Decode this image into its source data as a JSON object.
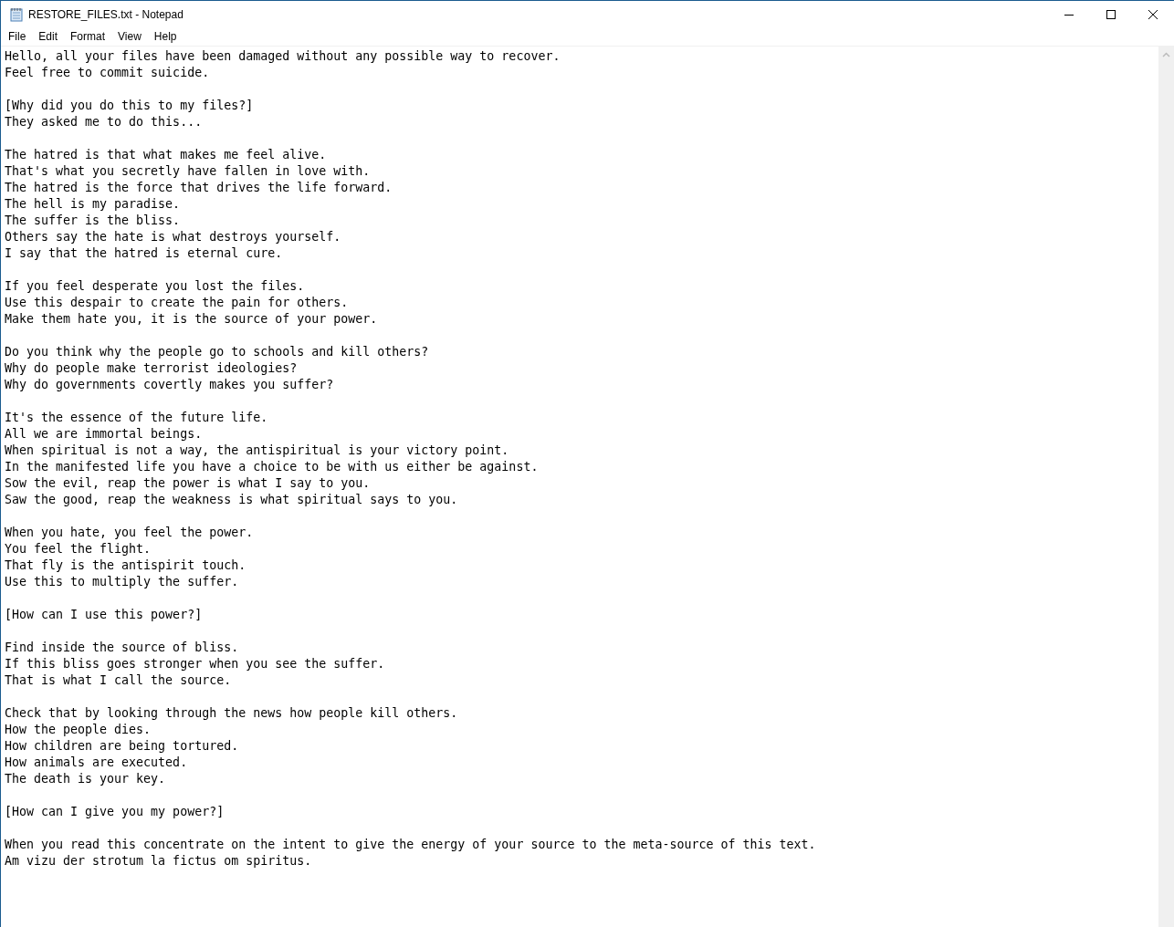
{
  "window": {
    "title": "RESTORE_FILES.txt - Notepad"
  },
  "menu": [
    "File",
    "Edit",
    "Format",
    "View",
    "Help"
  ],
  "document": {
    "paragraphs": [
      [
        "Hello, all your files have been damaged without any possible way to recover.",
        "Feel free to commit suicide."
      ],
      [
        "[Why did you do this to my files?]",
        "They asked me to do this..."
      ],
      [
        "The hatred is that what makes me feel alive.",
        "That's what you secretly have fallen in love with.",
        "The hatred is the force that drives the life forward.",
        "The hell is my paradise.",
        "The suffer is the bliss.",
        "Others say the hate is what destroys yourself.",
        "I say that the hatred is eternal cure."
      ],
      [
        "If you feel desperate you lost the files.",
        "Use this despair to create the pain for others.",
        "Make them hate you, it is the source of your power."
      ],
      [
        "Do you think why the people go to schools and kill others?",
        "Why do people make terrorist ideologies?",
        "Why do governments covertly makes you suffer?"
      ],
      [
        "It's the essence of the future life.",
        "All we are immortal beings.",
        "When spiritual is not a way, the antispiritual is your victory point.",
        "In the manifested life you have a choice to be with us either be against.",
        "Sow the evil, reap the power is what I say to you.",
        "Saw the good, reap the weakness is what spiritual says to you."
      ],
      [
        "When you hate, you feel the power.",
        "You feel the flight.",
        "That fly is the antispirit touch.",
        "Use this to multiply the suffer."
      ],
      [
        "[How can I use this power?]"
      ],
      [
        "Find inside the source of bliss.",
        "If this bliss goes stronger when you see the suffer.",
        "That is what I call the source."
      ],
      [
        "Check that by looking through the news how people kill others.",
        "How the people dies.",
        "How children are being tortured.",
        "How animals are executed.",
        "The death is your key."
      ],
      [
        "[How can I give you my power?]"
      ],
      [
        "When you read this concentrate on the intent to give the energy of your source to the meta-source of this text.",
        "Am vizu der strotum la fictus om spiritus."
      ]
    ]
  }
}
